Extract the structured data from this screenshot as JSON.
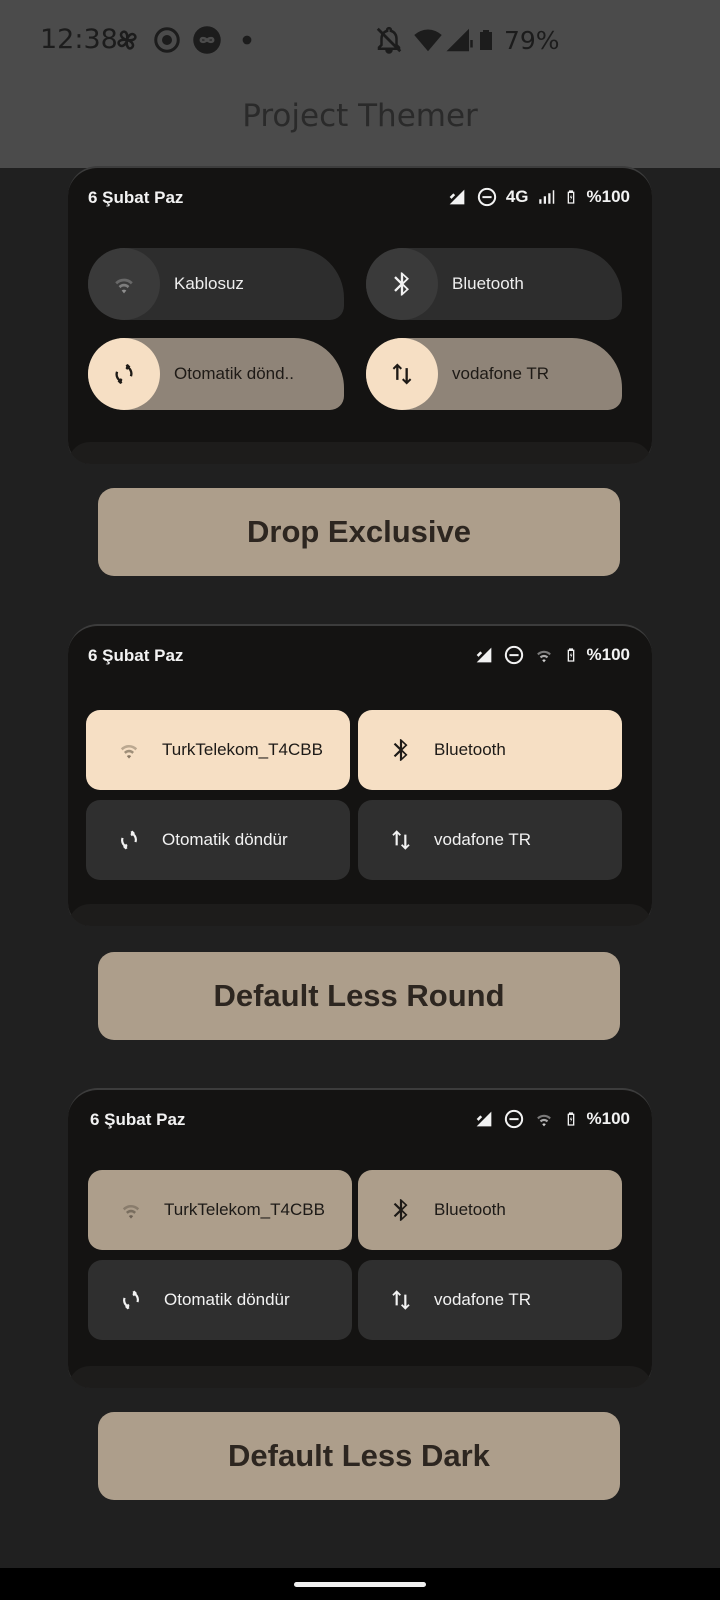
{
  "status_bar": {
    "time": "12:38",
    "battery": "79%",
    "icons": [
      "pinwheel-icon",
      "record-icon",
      "infinity-icon",
      "dot-icon",
      "bell-off-icon",
      "wifi-icon",
      "signal-icon",
      "battery-icon"
    ]
  },
  "app": {
    "title": "Project Themer"
  },
  "previews": [
    {
      "date": "6 Şubat Paz",
      "network": "4G",
      "battery": "%100",
      "tiles": [
        {
          "label": "Kablosuz",
          "icon": "wifi-icon",
          "active": false
        },
        {
          "label": "Bluetooth",
          "icon": "bluetooth-icon",
          "active": false
        },
        {
          "label": "Otomatik dönd..",
          "icon": "auto-rotate-icon",
          "active": true
        },
        {
          "label": "vodafone TR",
          "icon": "mobile-data-icon",
          "active": true
        }
      ]
    },
    {
      "date": "6 Şubat Paz",
      "battery": "%100",
      "tiles": [
        {
          "label": "TurkTelekom_T4CBB",
          "icon": "wifi-icon",
          "active": true
        },
        {
          "label": "Bluetooth",
          "icon": "bluetooth-icon",
          "active": true
        },
        {
          "label": "Otomatik döndür",
          "icon": "auto-rotate-icon",
          "active": false
        },
        {
          "label": "vodafone TR",
          "icon": "mobile-data-icon",
          "active": false
        }
      ]
    },
    {
      "date": "6 Şubat Paz",
      "battery": "%100",
      "tiles": [
        {
          "label": "TurkTelekom_T4CBB",
          "icon": "wifi-icon",
          "active": true
        },
        {
          "label": "Bluetooth",
          "icon": "bluetooth-icon",
          "active": true
        },
        {
          "label": "Otomatik döndür",
          "icon": "auto-rotate-icon",
          "active": false
        },
        {
          "label": "vodafone TR",
          "icon": "mobile-data-icon",
          "active": false
        }
      ]
    }
  ],
  "themes": [
    {
      "label": "Drop Exclusive"
    },
    {
      "label": "Default Less Round"
    },
    {
      "label": "Default Less Dark"
    }
  ],
  "colors": {
    "accent_light": "#f6dfc4",
    "accent_muted": "#ad9e8b",
    "tile_dark": "#2f2f2f",
    "card_bg": "#141312"
  }
}
